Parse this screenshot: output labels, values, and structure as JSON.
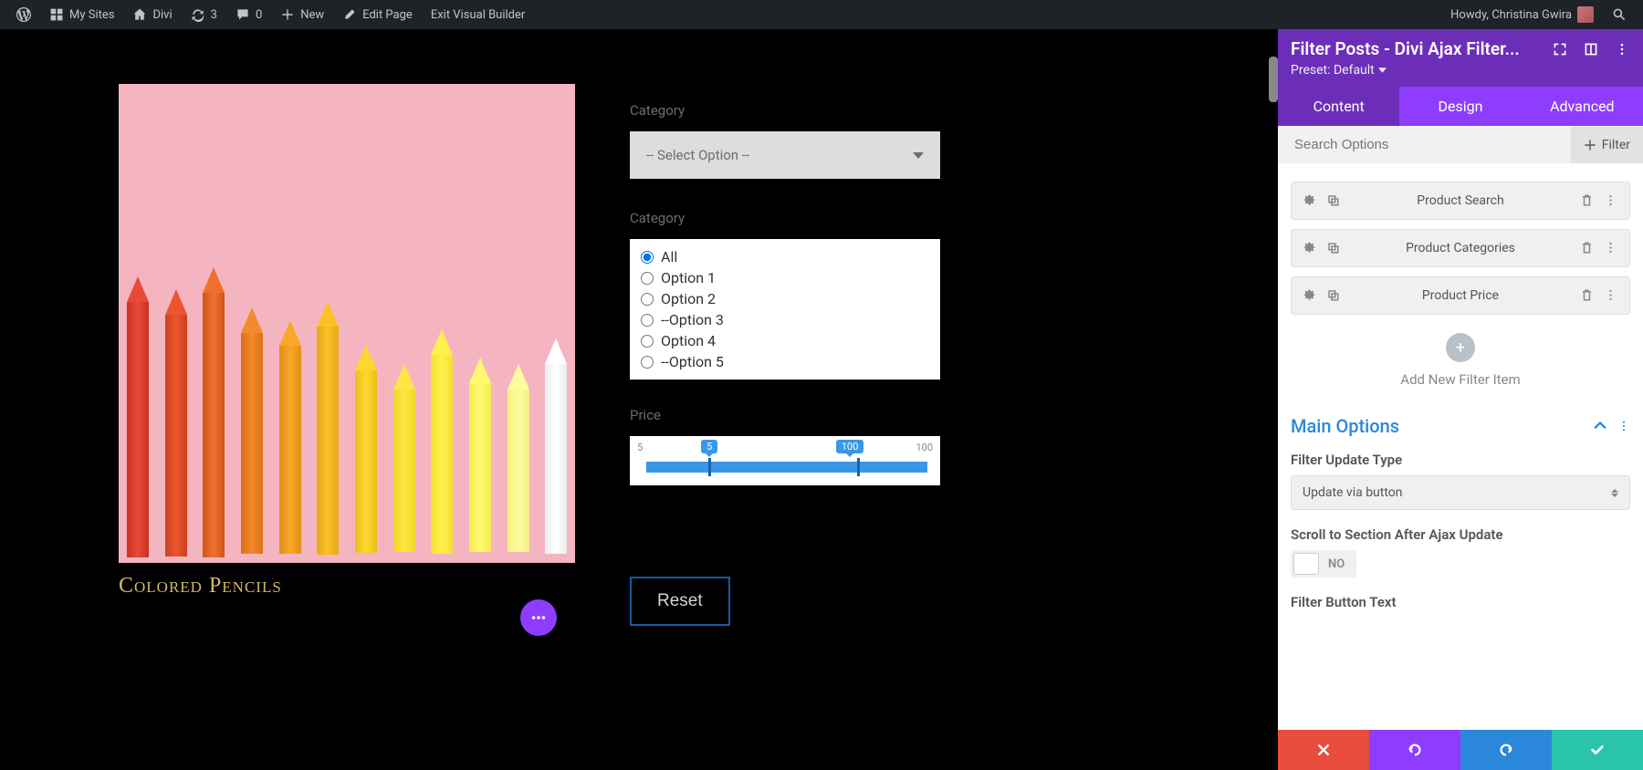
{
  "adminbar": {
    "my_sites": "My Sites",
    "divi": "Divi",
    "updates_count": "3",
    "comments_count": "0",
    "new": "New",
    "edit_page": "Edit Page",
    "exit_vb": "Exit Visual Builder",
    "greeting": "Howdy, Christina Gwira"
  },
  "canvas": {
    "product_title": "Colored Pencils",
    "category_label_1": "Category",
    "select_placeholder": "-- Select Option --",
    "category_label_2": "Category",
    "radios": [
      "All",
      "Option 1",
      "Option 2",
      "--Option 3",
      "Option 4",
      "--Option 5"
    ],
    "price_label": "Price",
    "price_min": "5",
    "price_low": "5",
    "price_high": "100",
    "price_max": "100",
    "reset_btn": "Reset"
  },
  "sidebar": {
    "title": "Filter Posts - Divi Ajax Filter...",
    "preset": "Preset: Default",
    "tabs": {
      "content": "Content",
      "design": "Design",
      "advanced": "Advanced"
    },
    "search_placeholder": "Search Options",
    "add_filter": "Filter",
    "filter_items": [
      "Product Search",
      "Product Categories",
      "Product Price"
    ],
    "add_new_label": "Add New Filter Item",
    "main_options": "Main Options",
    "filter_update_type_label": "Filter Update Type",
    "filter_update_type_value": "Update via button",
    "scroll_label": "Scroll to Section After Ajax Update",
    "toggle_no": "NO",
    "filter_button_text_label": "Filter Button Text"
  }
}
